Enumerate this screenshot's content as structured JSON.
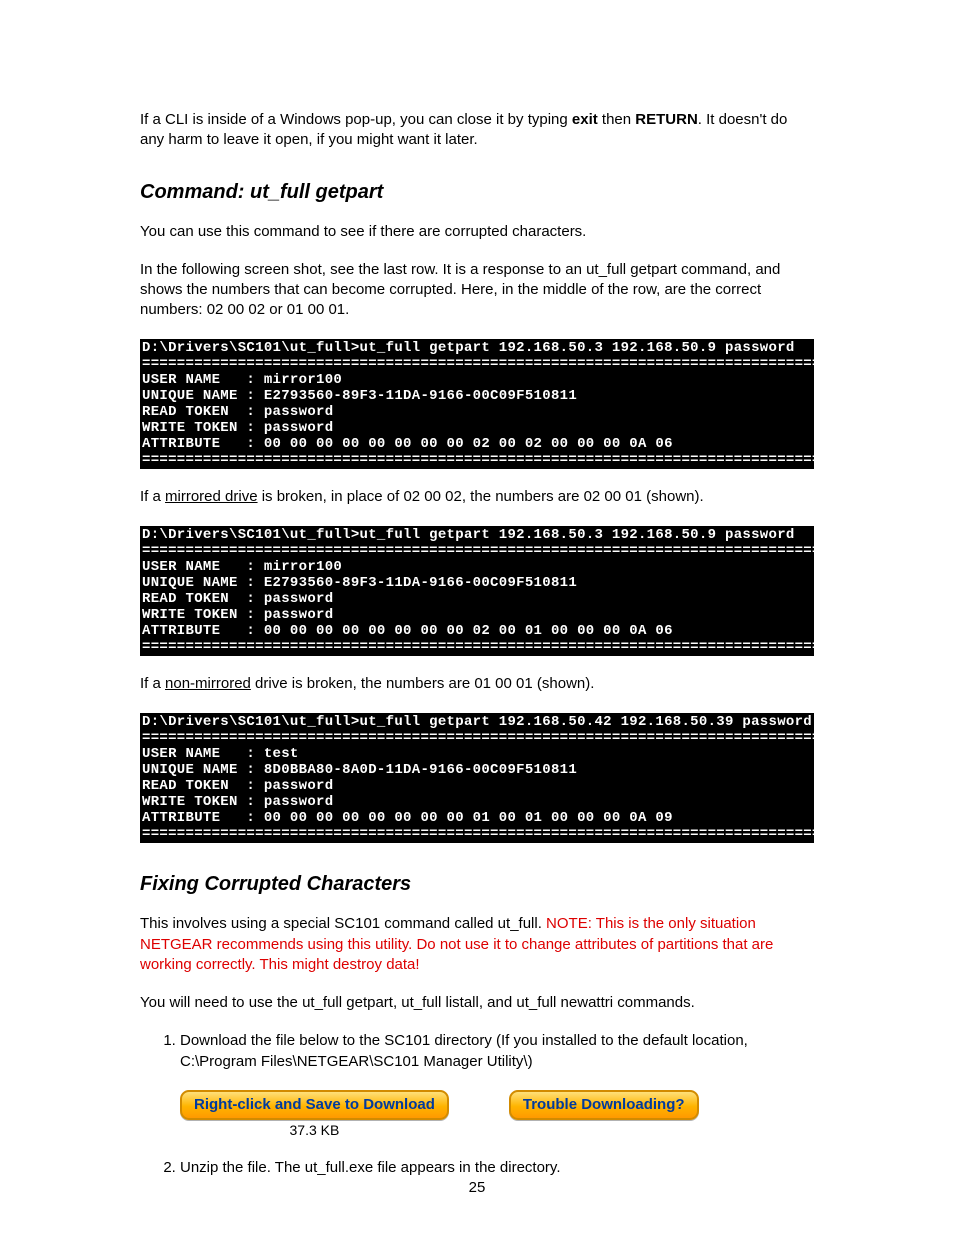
{
  "intro": {
    "p1a": "If a CLI is inside of a Windows pop-up, you can close it by typing ",
    "exit": "exit",
    "p1b": " then ",
    "return": "RETURN",
    "p1c": ". It doesn't do any harm to leave it open, if you might want it later."
  },
  "heading1": "Command: ut_full getpart",
  "s1": {
    "p1": "You can use this command to see if there are corrupted characters.",
    "p2": "In the following screen shot, see the last row. It is a response to an ut_full getpart command, and shows the numbers that can become corrupted. Here, in the middle of the row, are the correct numbers: 02 00 02 or 01 00 01."
  },
  "term1": "D:\\Drivers\\SC101\\ut_full>ut_full getpart 192.168.50.3 192.168.50.9 password\n==============================================================================\nUSER NAME   : mirror100\nUNIQUE NAME : E2793560-89F3-11DA-9166-00C09F510811\nREAD TOKEN  : password\nWRITE TOKEN : password\nATTRIBUTE   : 00 00 00 00 00 00 00 00 02 00 02 00 00 00 0A 06\n==============================================================================",
  "mid1a": "If a ",
  "mid1u": "mirrored drive",
  "mid1b": " is broken, in place of 02 00 02, the numbers are 02 00 01 (shown).",
  "term2": "D:\\Drivers\\SC101\\ut_full>ut_full getpart 192.168.50.3 192.168.50.9 password\n==============================================================================\nUSER NAME   : mirror100\nUNIQUE NAME : E2793560-89F3-11DA-9166-00C09F510811\nREAD TOKEN  : password\nWRITE TOKEN : password\nATTRIBUTE   : 00 00 00 00 00 00 00 00 02 00 01 00 00 00 0A 06\n==============================================================================",
  "mid2a": "If a ",
  "mid2u": "non-mirrored",
  "mid2b": " drive is broken, the numbers are 01 00 01 (shown).",
  "term3": "D:\\Drivers\\SC101\\ut_full>ut_full getpart 192.168.50.42 192.168.50.39 password\n==============================================================================\nUSER NAME   : test\nUNIQUE NAME : 8D0BBA80-8A0D-11DA-9166-00C09F510811\nREAD TOKEN  : password\nWRITE TOKEN : password\nATTRIBUTE   : 00 00 00 00 00 00 00 00 01 00 01 00 00 00 0A 09\n==============================================================================",
  "heading2": "Fixing Corrupted Characters",
  "fix": {
    "p1a": "This involves using a special SC101 command called ut_full. ",
    "warn": "NOTE: This is the only situation NETGEAR recommends using this utility. Do not use it to change attributes of partitions that are working correctly. This might destroy data!",
    "p2": "You will need to use the ut_full getpart, ut_full listall, and ut_full newattri commands.",
    "li1": "Download the file below to the SC101 directory (If you installed to the default location, C:\\Program Files\\NETGEAR\\SC101 Manager Utility\\)",
    "li2": "Unzip the file. The ut_full.exe file appears in the directory."
  },
  "buttons": {
    "download": "Right-click and Save to Download",
    "size": "37.3 KB",
    "trouble": "Trouble Downloading?"
  },
  "pagenum": "25"
}
